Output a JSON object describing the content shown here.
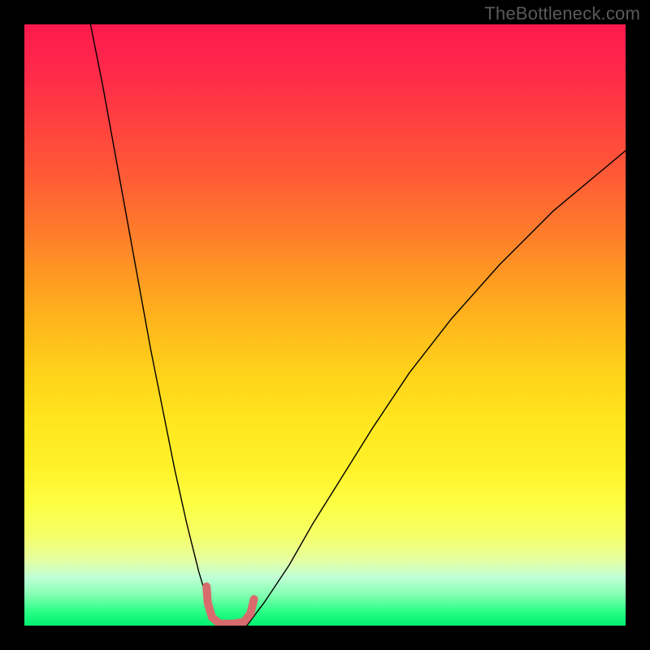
{
  "watermark": "TheBottleneck.com",
  "chart_data": {
    "type": "line",
    "title": "",
    "xlabel": "",
    "ylabel": "",
    "xlim": [
      0,
      100
    ],
    "ylim": [
      0,
      100
    ],
    "legend": false,
    "grid": false,
    "background_gradient": {
      "direction": "vertical",
      "stops": [
        {
          "pos": 0.0,
          "color": "#ff1a4d",
          "meaning": "high-bottleneck"
        },
        {
          "pos": 0.5,
          "color": "#ffb81c",
          "meaning": "moderate"
        },
        {
          "pos": 0.8,
          "color": "#fdff44",
          "meaning": "low"
        },
        {
          "pos": 1.0,
          "color": "#00f070",
          "meaning": "optimal"
        }
      ]
    },
    "series": [
      {
        "name": "bottleneck-curve-left",
        "color": "#000000",
        "width": 1.4,
        "x": [
          11,
          13,
          15,
          17,
          19,
          21,
          23,
          25,
          27,
          29,
          30.5,
          32.5
        ],
        "y": [
          100,
          90,
          79,
          68,
          57,
          46,
          36,
          26,
          17,
          9,
          4,
          0
        ]
      },
      {
        "name": "bottleneck-curve-right",
        "color": "#000000",
        "width": 1.4,
        "x": [
          37,
          40,
          44,
          48,
          53,
          58,
          64,
          71,
          79,
          88,
          100
        ],
        "y": [
          0,
          4,
          10,
          17,
          25,
          33,
          42,
          51,
          60,
          69,
          79
        ]
      },
      {
        "name": "optimal-marker",
        "color": "#d86b6d",
        "width": 10,
        "linecap": "round",
        "x": [
          30.3,
          30.5,
          31.2,
          32.5,
          34.5,
          36.5,
          37.6,
          38.2
        ],
        "y": [
          6.5,
          3.8,
          1.4,
          0.3,
          0.3,
          0.6,
          2.0,
          4.4
        ]
      }
    ]
  }
}
